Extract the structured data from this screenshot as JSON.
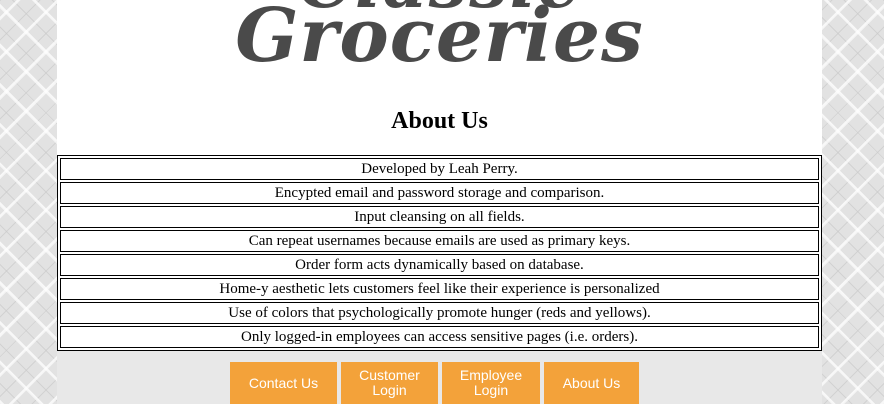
{
  "logo": {
    "line1": "Classic",
    "line2": "Groceries"
  },
  "page_title": "About Us",
  "features": [
    "Developed by Leah Perry.",
    "Encypted email and password storage and comparison.",
    "Input cleansing on all fields.",
    "Can repeat usernames because emails are used as primary keys.",
    "Order form acts dynamically based on database.",
    "Home-y aesthetic lets customers feel like their experience is personalized",
    "Use of colors that psychologically promote hunger (reds and yellows).",
    "Only logged-in employees can access sensitive pages (i.e. orders)."
  ],
  "nav": {
    "contact_us": "Contact Us",
    "customer_login_1": "Customer",
    "customer_login_2": "Login",
    "employee_login_1": "Employee",
    "employee_login_2": "Login",
    "about_us": "About Us"
  },
  "colors": {
    "nav_button": "#f3a23a",
    "logo": "#4a4a4a"
  }
}
